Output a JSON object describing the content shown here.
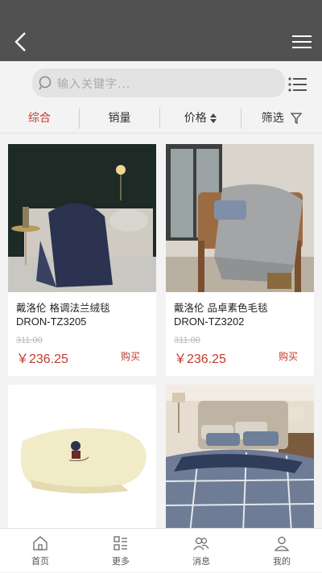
{
  "header": {
    "back_icon": "chevron-left-icon",
    "menu_icon": "hamburger-menu-icon"
  },
  "search": {
    "placeholder": "输入关键字...",
    "list_icon": "list-view-icon"
  },
  "sort_tabs": [
    {
      "label": "综合",
      "active": true
    },
    {
      "label": "销量"
    },
    {
      "label": "价格",
      "icon": "sort-arrows-icon"
    },
    {
      "label": "筛选",
      "icon": "filter-icon"
    }
  ],
  "products": [
    {
      "name": "戴洛伦 格调法兰绒毯",
      "model": "DRON-TZ3205",
      "old_price": "311.00",
      "price": "￥236.25",
      "buy": "购买"
    },
    {
      "name": "戴洛伦 品卓素色毛毯",
      "model": "DRON-TZ3202",
      "old_price": "311.00",
      "price": "￥236.25",
      "buy": "购买"
    },
    {
      "name": "",
      "model": "",
      "old_price": "",
      "price": "",
      "buy": ""
    },
    {
      "name": "",
      "model": "",
      "old_price": "",
      "price": "",
      "buy": ""
    }
  ],
  "bottom_nav": [
    {
      "label": "首页",
      "icon": "home-icon"
    },
    {
      "label": "更多",
      "icon": "grid-more-icon"
    },
    {
      "label": "消息",
      "icon": "users-message-icon"
    },
    {
      "label": "我的",
      "icon": "user-icon"
    }
  ],
  "colors": {
    "topbar": "#515151",
    "accent": "#c0392b",
    "background": "#f3f3f3"
  }
}
